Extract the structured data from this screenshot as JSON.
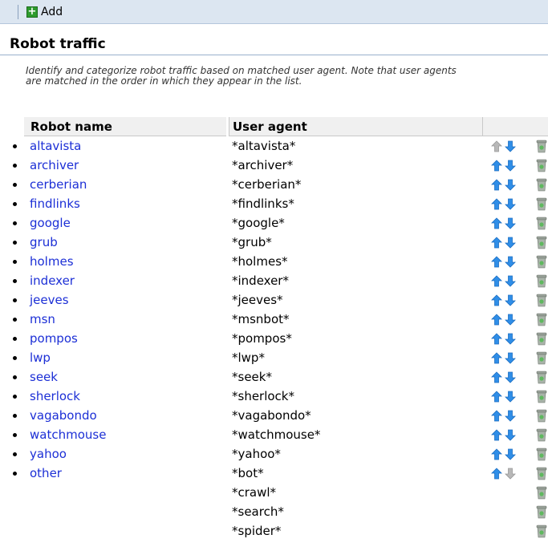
{
  "toolbar": {
    "add_label": "Add"
  },
  "section": {
    "title": "Robot traffic",
    "description_line1": "Identify and categorize robot traffic based on matched user agent. Note that user agents",
    "description_line2": "are matched in the order in which they appear in the list."
  },
  "columns": {
    "robot_name": "Robot name",
    "user_agent": "User agent"
  },
  "rows": [
    {
      "name": "altavista",
      "agent": "*altavista*",
      "up_enabled": false,
      "down_enabled": true
    },
    {
      "name": "archiver",
      "agent": "*archiver*",
      "up_enabled": true,
      "down_enabled": true
    },
    {
      "name": "cerberian",
      "agent": "*cerberian*",
      "up_enabled": true,
      "down_enabled": true
    },
    {
      "name": "findlinks",
      "agent": "*findlinks*",
      "up_enabled": true,
      "down_enabled": true
    },
    {
      "name": "google",
      "agent": "*google*",
      "up_enabled": true,
      "down_enabled": true
    },
    {
      "name": "grub",
      "agent": "*grub*",
      "up_enabled": true,
      "down_enabled": true
    },
    {
      "name": "holmes",
      "agent": "*holmes*",
      "up_enabled": true,
      "down_enabled": true
    },
    {
      "name": "indexer",
      "agent": "*indexer*",
      "up_enabled": true,
      "down_enabled": true
    },
    {
      "name": "jeeves",
      "agent": "*jeeves*",
      "up_enabled": true,
      "down_enabled": true
    },
    {
      "name": "msn",
      "agent": "*msnbot*",
      "up_enabled": true,
      "down_enabled": true
    },
    {
      "name": "pompos",
      "agent": "*pompos*",
      "up_enabled": true,
      "down_enabled": true
    },
    {
      "name": "lwp",
      "agent": "*lwp*",
      "up_enabled": true,
      "down_enabled": true
    },
    {
      "name": "seek",
      "agent": "*seek*",
      "up_enabled": true,
      "down_enabled": true
    },
    {
      "name": "sherlock",
      "agent": "*sherlock*",
      "up_enabled": true,
      "down_enabled": true
    },
    {
      "name": "vagabondo",
      "agent": "*vagabondo*",
      "up_enabled": true,
      "down_enabled": true
    },
    {
      "name": "watchmouse",
      "agent": "*watchmouse*",
      "up_enabled": true,
      "down_enabled": true
    },
    {
      "name": "yahoo",
      "agent": "*yahoo*",
      "up_enabled": true,
      "down_enabled": true
    },
    {
      "name": "other",
      "agent": "*bot*",
      "up_enabled": true,
      "down_enabled": false
    },
    {
      "name": "",
      "agent": "*crawl*",
      "up_enabled": null,
      "down_enabled": null
    },
    {
      "name": "",
      "agent": "*search*",
      "up_enabled": null,
      "down_enabled": null
    },
    {
      "name": "",
      "agent": "*spider*",
      "up_enabled": null,
      "down_enabled": null
    }
  ],
  "icons": {
    "add": "plus-icon",
    "up": "arrow-up-icon",
    "down": "arrow-down-icon",
    "delete": "trash-icon"
  },
  "colors": {
    "link": "#1c2fd6",
    "arrow_enabled": "#2f8ee8",
    "arrow_disabled": "#b8b8b8",
    "add_green": "#2e9b2e",
    "toolbar_bg": "#dce6f1"
  }
}
